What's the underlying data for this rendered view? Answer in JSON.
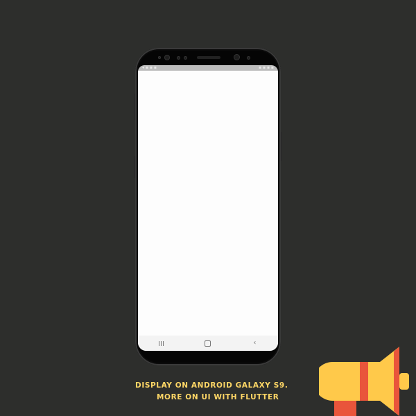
{
  "caption": {
    "line1": "DISPLAY ON ANDROID GALAXY S9.",
    "line2": "MORE ON UI WITH FLUTTER"
  },
  "status_bar": {
    "left": "◂ ▪ ▪ ▪",
    "right": "▪ ▪ ▪ ▪"
  },
  "navigation": {
    "recents_icon": "recents-icon",
    "home_icon": "home-icon",
    "back_icon": "back-icon",
    "back_glyph": "‹"
  },
  "colors": {
    "background": "#2d2e2c",
    "caption": "#ffd766",
    "megaphone_yellow": "#ffc94a",
    "megaphone_red": "#e9553b"
  }
}
